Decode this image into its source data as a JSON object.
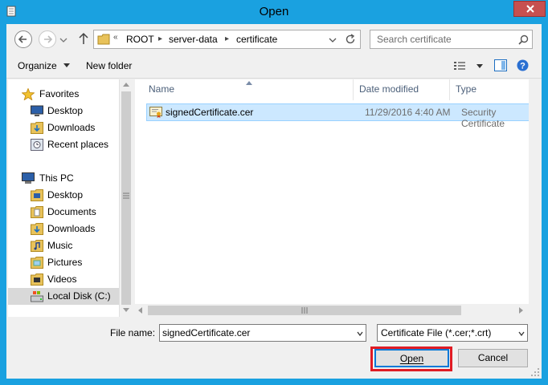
{
  "window": {
    "title": "Open",
    "close_icon": "close-icon"
  },
  "address": {
    "prefix": "«",
    "crumbs": [
      "ROOT",
      "server-data",
      "certificate"
    ]
  },
  "search": {
    "placeholder": "Search certificate"
  },
  "toolbar": {
    "organize_label": "Organize",
    "new_folder_label": "New folder"
  },
  "nav": {
    "favorites_label": "Favorites",
    "favorites": [
      "Desktop",
      "Downloads",
      "Recent places"
    ],
    "this_pc_label": "This PC",
    "pc_items": [
      "Desktop",
      "Documents",
      "Downloads",
      "Music",
      "Pictures",
      "Videos",
      "Local Disk (C:)"
    ]
  },
  "columns": {
    "name": "Name",
    "date": "Date modified",
    "type": "Type"
  },
  "files": [
    {
      "name": "signedCertificate.cer",
      "date": "11/29/2016 4:40 AM",
      "type": "Security Certificate",
      "selected": true
    }
  ],
  "footer": {
    "file_name_label": "File name:",
    "file_name_value": "signedCertificate.cer",
    "filter_value": "Certificate File (*.cer;*.crt)",
    "open_label": "Open",
    "cancel_label": "Cancel"
  },
  "colors": {
    "frame": "#1aa1e0",
    "selection": "#cce8ff",
    "highlight": "#e01b24"
  }
}
